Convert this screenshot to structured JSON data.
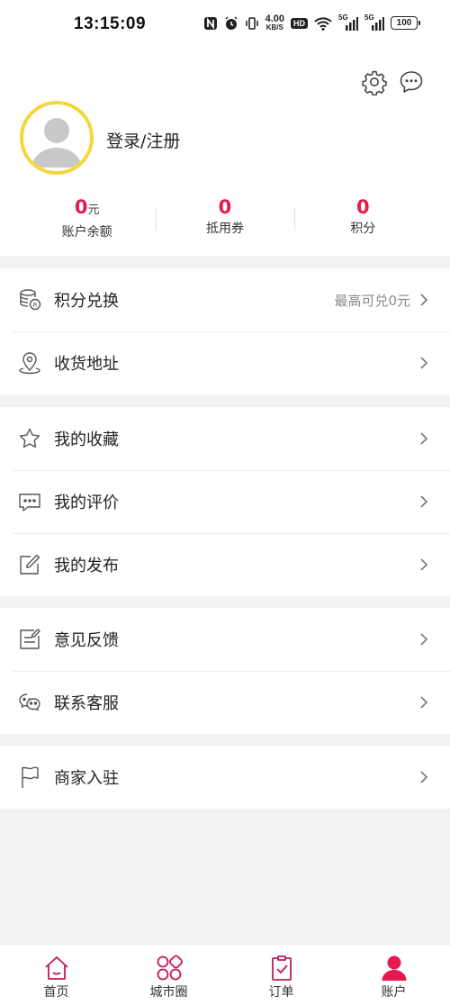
{
  "status_bar": {
    "time": "13:15:09",
    "net_speed_value": "4.00",
    "net_speed_unit": "KB/S",
    "hd_badge": "HD",
    "signal_1": "5G",
    "signal_2": "5G",
    "battery": "100"
  },
  "header": {
    "settings_icon": "gear-icon",
    "message_icon": "chat-bubble-icon"
  },
  "profile": {
    "login_label": "登录/注册",
    "avatar_border_color": "#f5d638"
  },
  "stats": [
    {
      "value": "0",
      "unit": "元",
      "label": "账户余额"
    },
    {
      "value": "0",
      "unit": "",
      "label": "抵用券"
    },
    {
      "value": "0",
      "unit": "",
      "label": "积分"
    }
  ],
  "menu": {
    "points_exchange": {
      "icon": "coin-stack-icon",
      "label": "积分兑换",
      "extra": "最高可兑0元"
    },
    "shipping_address": {
      "icon": "location-pin-icon",
      "label": "收货地址"
    },
    "favorites": {
      "icon": "star-icon",
      "label": "我的收藏"
    },
    "reviews": {
      "icon": "comment-icon",
      "label": "我的评价"
    },
    "posts": {
      "icon": "edit-icon",
      "label": "我的发布"
    },
    "feedback": {
      "icon": "feedback-icon",
      "label": "意见反馈"
    },
    "customer_service": {
      "icon": "wechat-icon",
      "label": "联系客服"
    },
    "merchant_join": {
      "icon": "flag-icon",
      "label": "商家入驻"
    }
  },
  "tabbar": [
    {
      "label": "首页",
      "icon": "home-icon"
    },
    {
      "label": "城市圈",
      "icon": "grid-circles-icon"
    },
    {
      "label": "订单",
      "icon": "clipboard-check-icon"
    },
    {
      "label": "账户",
      "icon": "user-icon"
    }
  ],
  "colors": {
    "accent": "#e5194d",
    "tab_icon": "#c2185b",
    "background": "#f2f2f2"
  }
}
